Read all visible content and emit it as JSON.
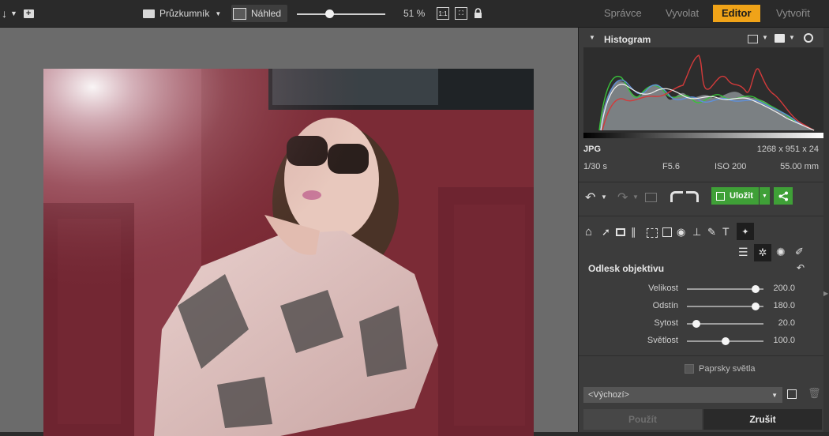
{
  "toolbar": {
    "left_icons": [
      "sort-icon",
      "chevron-down-icon",
      "new-folder-icon"
    ],
    "explorer_label": "Průzkumník",
    "preview_label": "Náhled",
    "zoom_value": "51 %",
    "zoom_percent": 51,
    "one_to_one_label": "1:1",
    "modes": [
      "Správce",
      "Vyvolat",
      "Editor",
      "Vytvořit"
    ],
    "active_mode": "Editor",
    "colors": {
      "accent": "#f0a318",
      "background": "#2a2a2a"
    }
  },
  "histogram": {
    "title": "Histogram",
    "icons": [
      "selection-icon",
      "chevron-down-icon",
      "mask-icon",
      "chevron-down-icon",
      "circle-icon"
    ]
  },
  "photo_info": {
    "format": "JPG",
    "dimensions": "1268 x 951 x 24",
    "shutter": "1/30 s",
    "aperture": "F5.6",
    "iso": "ISO 200",
    "focal": "55.00 mm"
  },
  "actions": {
    "save_label": "Uložit",
    "icons": [
      "undo-icon",
      "redo-icon",
      "image-icon",
      "rotate-left-icon",
      "rotate-right-icon",
      "share-icon"
    ]
  },
  "tools": {
    "icons": [
      "home-icon",
      "pointer-icon",
      "crop-icon",
      "perspective-icon",
      "selection-icon",
      "text-box-icon",
      "eye-icon",
      "level-icon",
      "brush-icon",
      "text-icon",
      "effects-icon"
    ],
    "sub_icons": [
      "lines-icon",
      "sun-icon",
      "star-burst-icon",
      "pen-icon"
    ]
  },
  "lens_flare": {
    "title": "Odlesk objektivu",
    "params": [
      {
        "label": "Velikost",
        "value": "200.0",
        "level": 0.9
      },
      {
        "label": "Odstín",
        "value": "180.0",
        "level": 0.9
      },
      {
        "label": "Sytost",
        "value": "20.0",
        "level": 0.12
      },
      {
        "label": "Světlost",
        "value": "100.0",
        "level": 0.5
      }
    ],
    "rays_label": "Paprsky světla"
  },
  "preset": {
    "value": "<Výchozí>",
    "apply_label": "Použít",
    "cancel_label": "Zrušit"
  }
}
